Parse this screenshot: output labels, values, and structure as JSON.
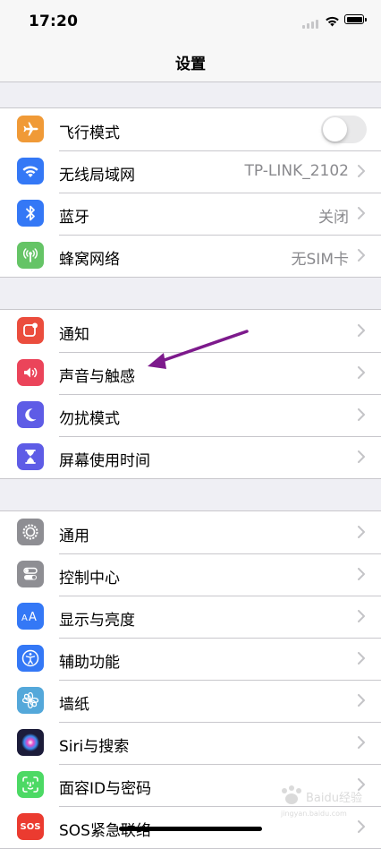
{
  "status_bar": {
    "time": "17:20"
  },
  "nav": {
    "title": "设置"
  },
  "groups": [
    {
      "rows": [
        {
          "label": "飞行模式",
          "icon": "airplane-icon",
          "color": "#f09a37",
          "toggle": false
        },
        {
          "label": "无线局域网",
          "value": "TP-LINK_2102",
          "icon": "wifi-icon",
          "color": "#3478f6"
        },
        {
          "label": "蓝牙",
          "value": "关闭",
          "icon": "bluetooth-icon",
          "color": "#3478f6"
        },
        {
          "label": "蜂窝网络",
          "value": "无SIM卡",
          "icon": "cellular-icon",
          "color": "#65c466"
        }
      ]
    },
    {
      "rows": [
        {
          "label": "通知",
          "icon": "notifications-icon",
          "color": "#eb4d3d"
        },
        {
          "label": "声音与触感",
          "icon": "speaker-icon",
          "color": "#eb445a"
        },
        {
          "label": "勿扰模式",
          "icon": "moon-icon",
          "color": "#5e5ce6"
        },
        {
          "label": "屏幕使用时间",
          "icon": "hourglass-icon",
          "color": "#5e5ce6"
        }
      ]
    },
    {
      "rows": [
        {
          "label": "通用",
          "icon": "gear-icon",
          "color": "#8e8e93"
        },
        {
          "label": "控制中心",
          "icon": "switches-icon",
          "color": "#8e8e93"
        },
        {
          "label": "显示与亮度",
          "icon": "text-size-icon",
          "color": "#3478f6"
        },
        {
          "label": "辅助功能",
          "icon": "accessibility-icon",
          "color": "#3478f6"
        },
        {
          "label": "墙纸",
          "icon": "flower-icon",
          "color": "#54a8da"
        },
        {
          "label": "Siri与搜索",
          "icon": "siri-icon",
          "color": "#1c1c3a"
        },
        {
          "label": "面容ID与密码",
          "icon": "face-id-icon",
          "color": "#4cd964"
        },
        {
          "label": "SOS紧急联络",
          "icon": "sos-icon",
          "color": "#eb3b30",
          "icon_text": "SOS"
        }
      ]
    }
  ],
  "watermark": {
    "text": "Baidu经验",
    "subtext": "jingyan.baidu.com"
  }
}
